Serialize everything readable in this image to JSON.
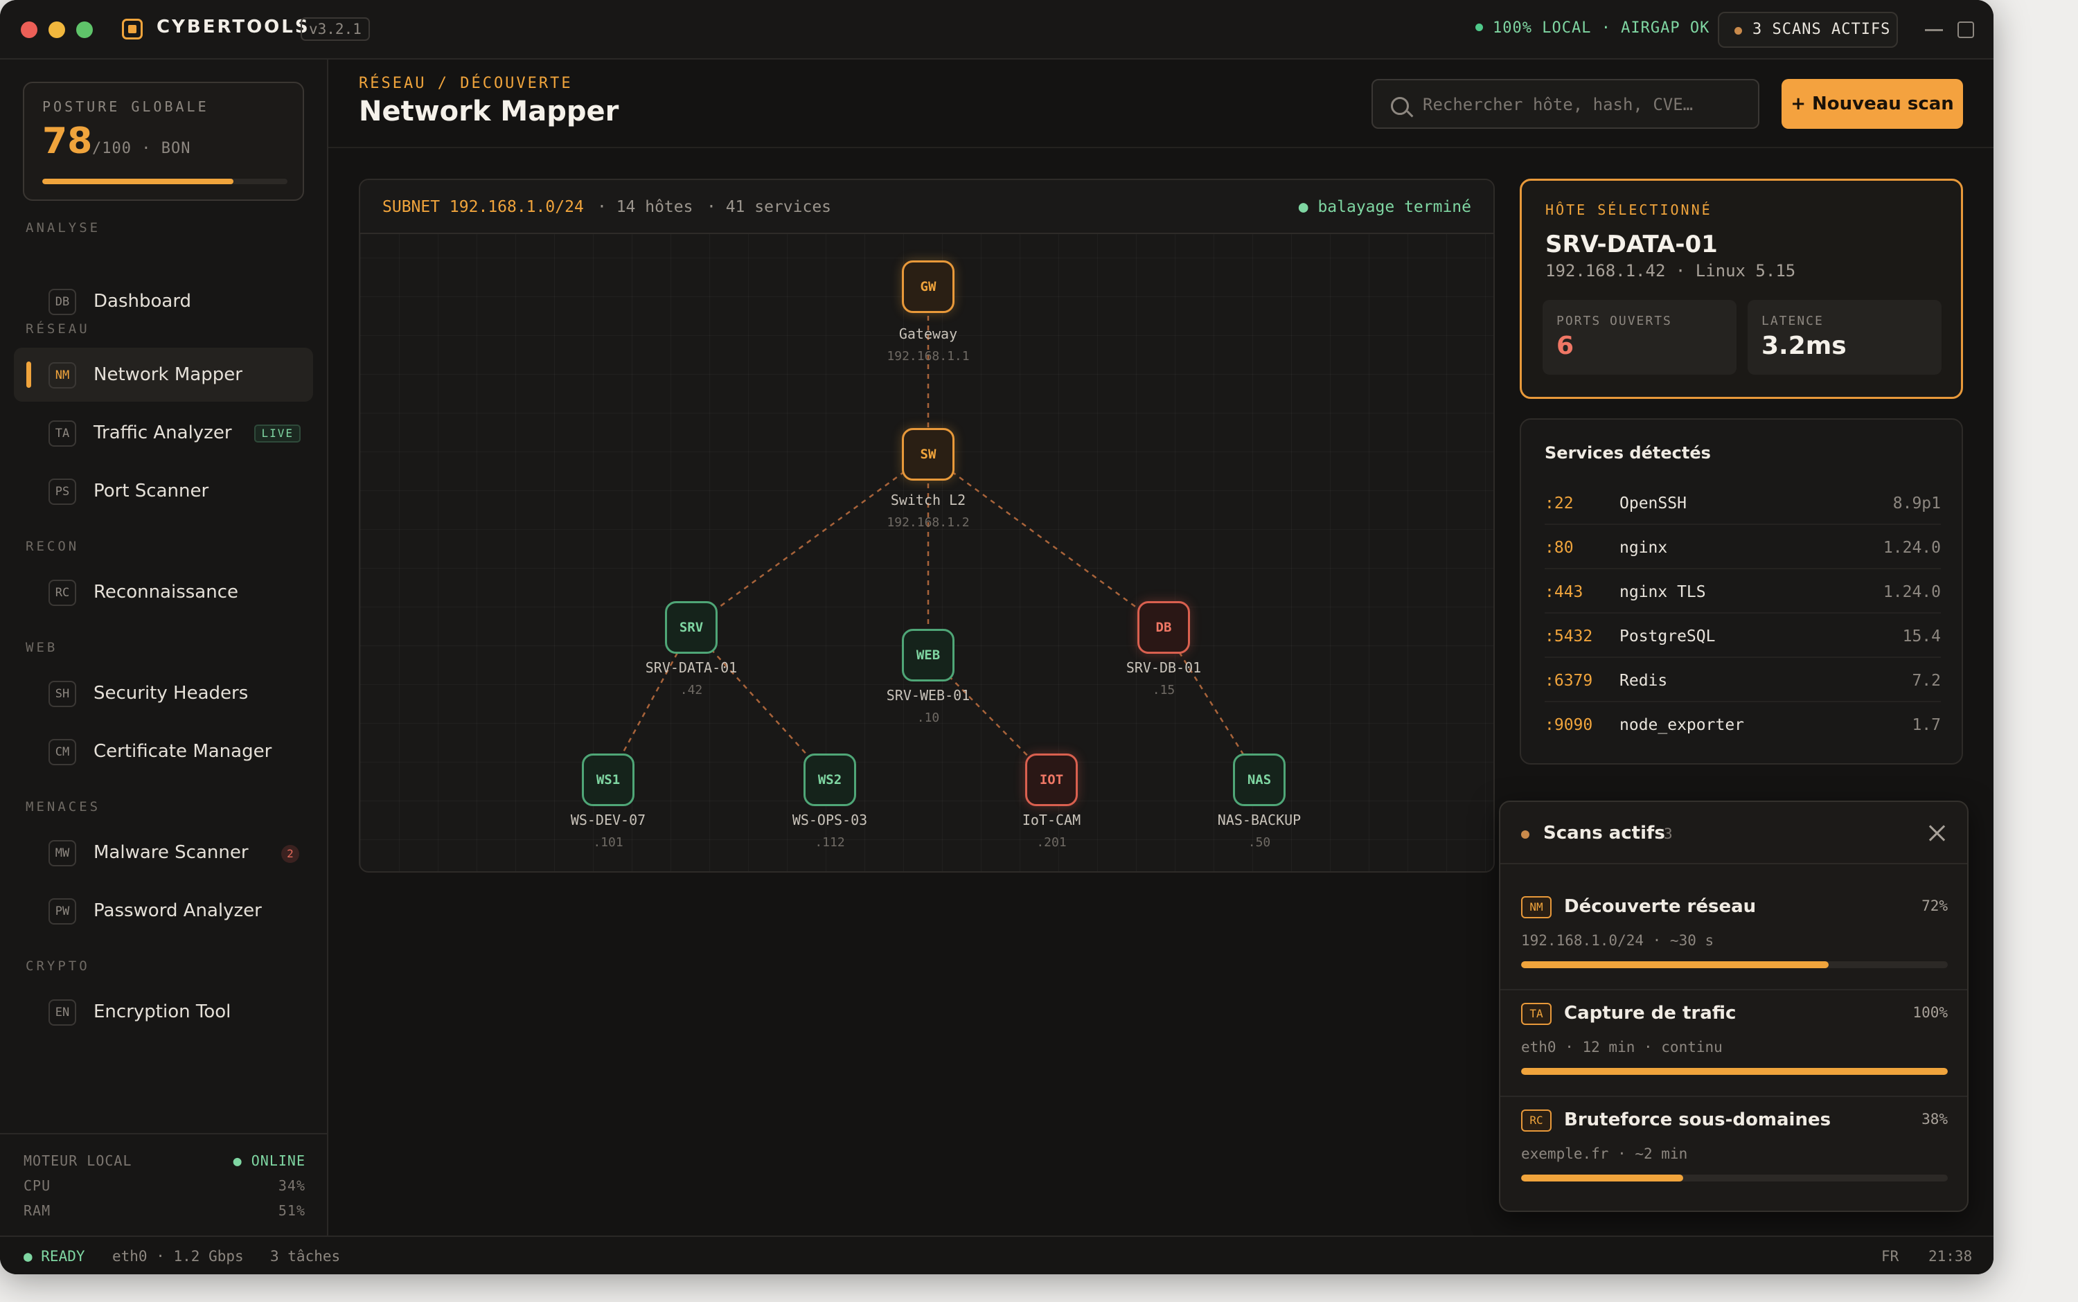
{
  "app": {
    "name": "CYBERTOOLS",
    "version": "v3.2.1",
    "local_status": "100% LOCAL · AIRGAP OK",
    "scans_badge": "3 SCANS ACTIFS"
  },
  "posture": {
    "label": "POSTURE GLOBALE",
    "score": "78",
    "suffix": "/100 · BON",
    "fill": 0.78
  },
  "sidebar": {
    "sections": [
      {
        "label": "ANALYSE",
        "items": [
          {
            "abbr": "DB",
            "label": "Dashboard"
          }
        ]
      },
      {
        "label": "RÉSEAU",
        "items": [
          {
            "abbr": "NM",
            "label": "Network Mapper",
            "active": true
          },
          {
            "abbr": "TA",
            "label": "Traffic Analyzer",
            "badge": "LIVE"
          },
          {
            "abbr": "PS",
            "label": "Port Scanner"
          }
        ]
      },
      {
        "label": "RECON",
        "items": [
          {
            "abbr": "RC",
            "label": "Reconnaissance"
          }
        ]
      },
      {
        "label": "WEB",
        "items": [
          {
            "abbr": "SH",
            "label": "Security Headers"
          },
          {
            "abbr": "CM",
            "label": "Certificate Manager"
          }
        ]
      },
      {
        "label": "MENACES",
        "items": [
          {
            "abbr": "MW",
            "label": "Malware Scanner",
            "count": "2"
          },
          {
            "abbr": "PW",
            "label": "Password Analyzer"
          }
        ]
      },
      {
        "label": "CRYPTO",
        "items": [
          {
            "abbr": "EN",
            "label": "Encryption Tool"
          }
        ]
      }
    ]
  },
  "engine": {
    "label": "MOTEUR LOCAL",
    "status": "● ONLINE",
    "cpu_label": "CPU",
    "cpu": "34%",
    "ram_label": "RAM",
    "ram": "51%"
  },
  "header": {
    "breadcrumb": "RÉSEAU / DÉCOUVERTE",
    "title": "Network Mapper",
    "search_placeholder": "Rechercher hôte, hash, CVE…",
    "new_scan": "+ Nouveau scan"
  },
  "map": {
    "subnet": "SUBNET 192.168.1.0/24",
    "hosts": "· 14 hôtes",
    "services": "· 41 services",
    "state": "● balayage terminé",
    "nodes": [
      {
        "id": "gw",
        "code": "GW",
        "label": "Gateway",
        "ip": "192.168.1.1",
        "tone": "or"
      },
      {
        "id": "sw",
        "code": "SW",
        "label": "Switch L2",
        "ip": "192.168.1.2",
        "tone": "or"
      },
      {
        "id": "srv",
        "code": "SRV",
        "label": "SRV-DATA-01",
        "ip": ".42",
        "tone": "gr"
      },
      {
        "id": "web",
        "code": "WEB",
        "label": "SRV-WEB-01",
        "ip": ".10",
        "tone": "gr"
      },
      {
        "id": "db",
        "code": "DB",
        "label": "SRV-DB-01",
        "ip": ".15",
        "tone": "rd"
      },
      {
        "id": "ws1",
        "code": "WS1",
        "label": "WS-DEV-07",
        "ip": ".101",
        "tone": "gr"
      },
      {
        "id": "ws2",
        "code": "WS2",
        "label": "WS-OPS-03",
        "ip": ".112",
        "tone": "gr"
      },
      {
        "id": "iot",
        "code": "IOT",
        "label": "IoT-CAM",
        "ip": ".201",
        "tone": "rd"
      },
      {
        "id": "nas",
        "code": "NAS",
        "label": "NAS-BACKUP",
        "ip": ".50",
        "tone": "gr"
      }
    ]
  },
  "selected_host": {
    "title": "HÔTE SÉLECTIONNÉ",
    "name": "SRV-DATA-01",
    "info": "192.168.1.42 · Linux 5.15",
    "ports_label": "PORTS OUVERTS",
    "ports": "6",
    "latency_label": "LATENCE",
    "latency": "3.2ms"
  },
  "services": {
    "title": "Services détectés",
    "rows": [
      {
        "port": ":22",
        "name": "OpenSSH",
        "version": "8.9p1"
      },
      {
        "port": ":80",
        "name": "nginx",
        "version": "1.24.0"
      },
      {
        "port": ":443",
        "name": "nginx TLS",
        "version": "1.24.0"
      },
      {
        "port": ":5432",
        "name": "PostgreSQL",
        "version": "15.4"
      },
      {
        "port": ":6379",
        "name": "Redis",
        "version": "7.2"
      },
      {
        "port": ":9090",
        "name": "node_exporter",
        "version": "1.7"
      }
    ]
  },
  "active_scans": {
    "title": "Scans actifs",
    "count": "3",
    "items": [
      {
        "abbr": "NM",
        "name": "Découverte réseau",
        "percent": "72%",
        "progress": 0.72,
        "meta": "192.168.1.0/24 · ~30 s"
      },
      {
        "abbr": "TA",
        "name": "Capture de trafic",
        "percent": "100%",
        "progress": 1.0,
        "meta": "eth0 · 12 min · continu"
      },
      {
        "abbr": "RC",
        "name": "Bruteforce sous-domaines",
        "percent": "38%",
        "progress": 0.38,
        "meta": "exemple.fr · ~2 min"
      }
    ]
  },
  "statusbar": {
    "ready": "● READY",
    "iface": "eth0 · 1.2 Gbps",
    "tasks": "3 tâches",
    "lang": "FR",
    "time": "21:38"
  }
}
